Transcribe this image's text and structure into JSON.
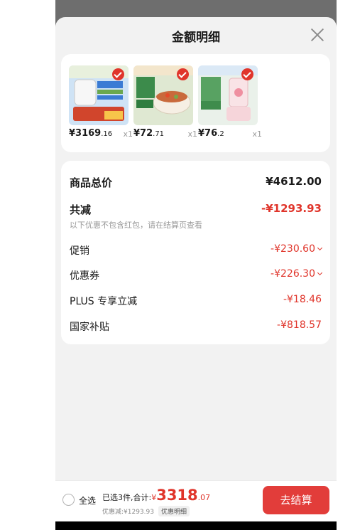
{
  "sheet": {
    "title": "金额明细"
  },
  "products": [
    {
      "name": "product-1",
      "price_int": "¥3169",
      "price_dec": ".16",
      "qty": "x1",
      "colors": [
        "#cfe3f5",
        "#e8f0dd",
        "#d1452c"
      ]
    },
    {
      "name": "product-2",
      "price_int": "¥72",
      "price_dec": ".71",
      "qty": "x1",
      "colors": [
        "#dfe8d2",
        "#f3e6cc",
        "#3c8b4b"
      ]
    },
    {
      "name": "product-3",
      "price_int": "¥76",
      "price_dec": ".2",
      "qty": "x1",
      "colors": [
        "#eaf1ea",
        "#f6d5da",
        "#58a262"
      ]
    }
  ],
  "summary": {
    "total_label": "商品总价",
    "total_value": "¥4612.00",
    "reduce_label": "共减",
    "reduce_value": "-¥1293.93",
    "reduce_note": "以下优惠不包含红包，请在结算页查看",
    "items": [
      {
        "label": "促销",
        "value": "-¥230.60",
        "expandable": true
      },
      {
        "label": "优惠券",
        "value": "-¥226.30",
        "expandable": true
      },
      {
        "label": "PLUS 专享立减",
        "value": "-¥18.46",
        "expandable": false
      },
      {
        "label": "国家补贴",
        "value": "-¥818.57",
        "expandable": false
      }
    ]
  },
  "bottom": {
    "select_all": "全选",
    "selected_text": "已选3件,合计:",
    "yen": "¥",
    "amount_int": "3318",
    "amount_dec": ".07",
    "discount_text": "优惠减:¥1293.93",
    "discount_detail": "优惠明细",
    "checkout": "去结算"
  },
  "colors": {
    "accent": "#e0352b",
    "checkout_bg": "#e23d3a",
    "sheet_bg": "#f2f2f2",
    "overlay": "#6e6e6e"
  },
  "icons": [
    "close-icon",
    "check-icon",
    "chevron-down-icon",
    "radio-icon"
  ]
}
